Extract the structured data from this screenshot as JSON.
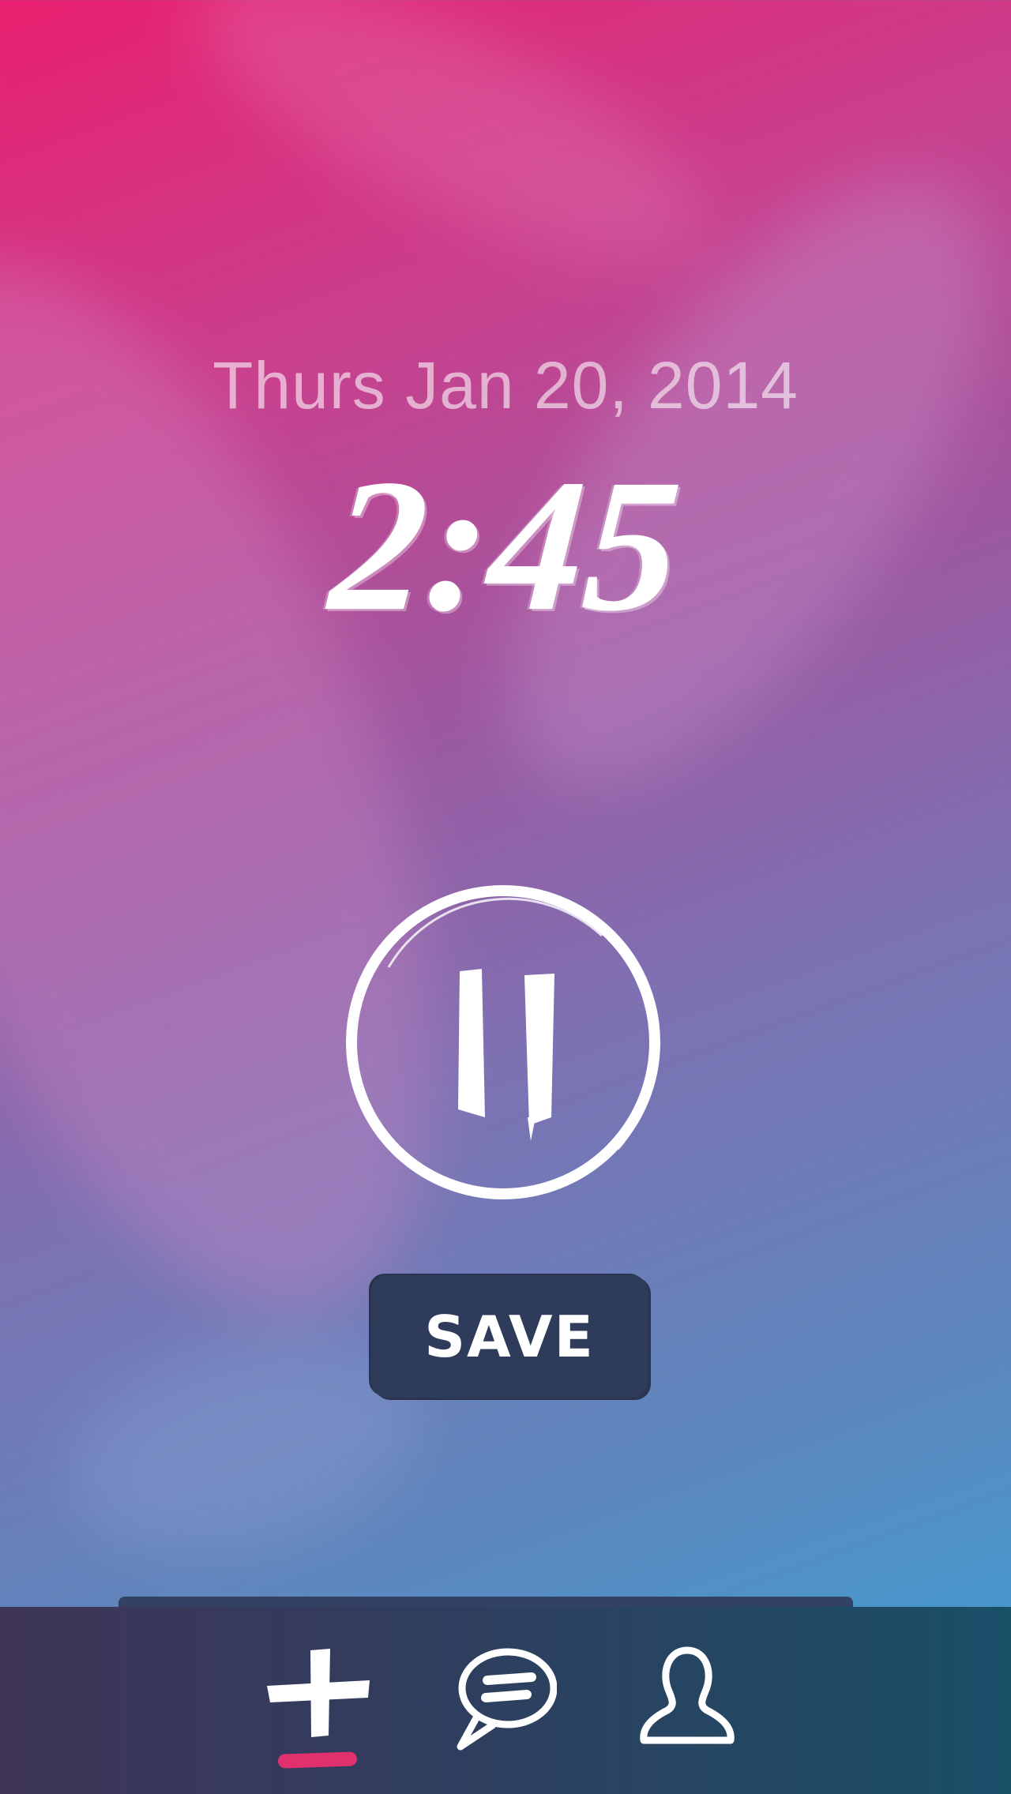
{
  "screen": {
    "date_text": "Thurs Jan 20, 2014",
    "time_text": "2:45"
  },
  "controls": {
    "pause_icon": "pause-icon",
    "save_label": "SAVE"
  },
  "tabbar": {
    "tabs": [
      {
        "icon": "plus-icon",
        "active": true
      },
      {
        "icon": "chat-icon",
        "active": false
      },
      {
        "icon": "profile-icon",
        "active": false
      }
    ],
    "active_color": "#e0306e"
  },
  "colors": {
    "gradient_top": "#e8206f",
    "gradient_bottom": "#3aa3d6",
    "button_bg": "#2f3b5a",
    "tabbar_bg": "#2f3e5e"
  }
}
